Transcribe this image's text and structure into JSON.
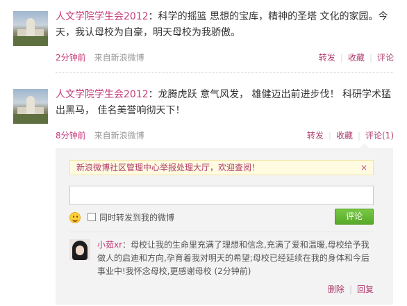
{
  "posts": [
    {
      "author": "人文学院学生会2012",
      "text": "：科学的摇篮 思想的宝库，精神的圣塔 文化的家园。今天，我认母校为自豪，明天母校为我骄傲。",
      "time": "2分钟前",
      "via": "来自",
      "source": "新浪微博",
      "actions": {
        "forward": "转发",
        "favorite": "收藏",
        "comment": "评论"
      }
    },
    {
      "author": "人文学院学生会2012",
      "text": "：龙腾虎跃 意气风发， 雄健迈出前进步伐！ 科研学术猛出黑马， 佳名美誉响彻天下！",
      "time": "8分钟前",
      "via": "来自",
      "source": "新浪微博",
      "actions": {
        "forward": "转发",
        "favorite": "收藏",
        "comment": "评论(1)"
      }
    }
  ],
  "comment_box": {
    "notice": "新浪微博社区管理中心举报处理大厅，欢迎查阅！",
    "notice_close": "×",
    "input_value": "",
    "emoji_icon": "smiley-icon",
    "forward_checkbox_label": "同时转发到我的微博",
    "forward_checked": false,
    "submit_label": "评论",
    "comments": [
      {
        "name": "小茹xr",
        "text": "：母校让我的生命里充满了理想和信念,充满了爱和温暖,母校给予我做人的启迪和方向,孕育着我对明天的希望;母校已经延续在我的身体和今后事业中!我怀念母校,更感谢母校",
        "time": "(2分钟前)",
        "delete_label": "删除",
        "reply_label": "回复"
      }
    ]
  },
  "colors": {
    "accent": "#c43a79",
    "link": "#b03d6e",
    "submit": "#66b934",
    "notice_bg": "#fffbe1"
  }
}
